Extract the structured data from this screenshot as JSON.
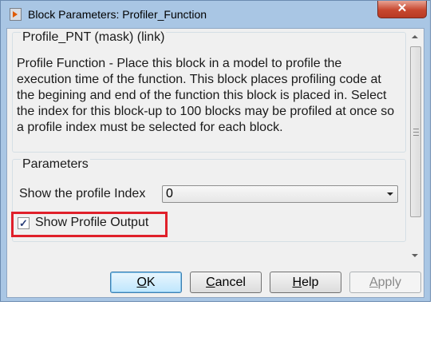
{
  "window": {
    "title": "Block Parameters: Profiler_Function",
    "close_glyph": "✕",
    "icon": "simulink-block-icon"
  },
  "mask_group": {
    "legend": "Profile_PNT (mask) (link)",
    "description": "Profile Function - Place this block in a model to profile the execution time of the function.  This block places profiling code at the begining and end of the function this block is placed in. Select the index for this block-up to 100 blocks may be profiled at once so a profile index must be selected for each block."
  },
  "parameters": {
    "legend": "Parameters",
    "index_label": "Show the profile Index",
    "index_value": "0",
    "show_output_label": "Show Profile Output",
    "show_output_checked": true,
    "check_glyph": "✓",
    "highlight_color": "#e0202a"
  },
  "buttons": {
    "ok": {
      "mnemonic": "O",
      "rest": "K"
    },
    "cancel": {
      "mnemonic": "C",
      "rest": "ancel"
    },
    "help": {
      "mnemonic": "H",
      "rest": "elp"
    },
    "apply": {
      "mnemonic": "A",
      "rest": "pply",
      "disabled": true
    }
  }
}
